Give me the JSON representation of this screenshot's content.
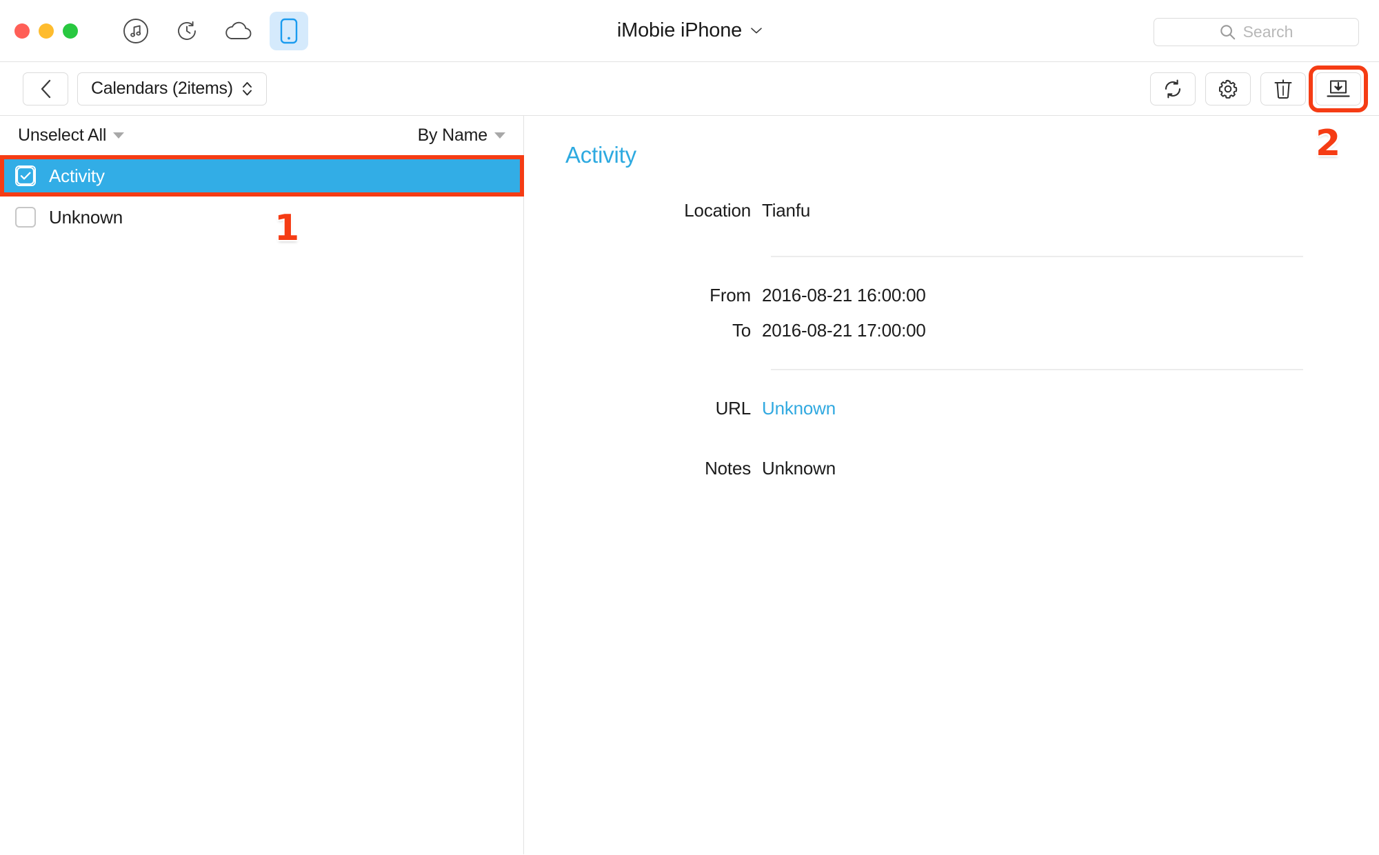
{
  "titlebar": {
    "device_title": "iMobie iPhone",
    "tabs": [
      {
        "name": "music-tab",
        "icon": "music-note-icon",
        "active": false
      },
      {
        "name": "backup-tab",
        "icon": "history-clock-icon",
        "active": false
      },
      {
        "name": "cloud-tab",
        "icon": "cloud-icon",
        "active": false
      },
      {
        "name": "device-tab",
        "icon": "phone-icon",
        "active": true
      }
    ],
    "window_controls": [
      "close",
      "minimize",
      "maximize"
    ]
  },
  "search": {
    "placeholder": "Search",
    "value": ""
  },
  "subtoolbar": {
    "back_label": "Back",
    "breadcrumb_label": "Calendars (2items)",
    "actions": [
      {
        "name": "refresh-button",
        "icon": "refresh-icon",
        "highlighted": false
      },
      {
        "name": "settings-button",
        "icon": "gear-icon",
        "highlighted": false
      },
      {
        "name": "delete-button",
        "icon": "trash-icon",
        "highlighted": false
      },
      {
        "name": "export-button",
        "icon": "export-to-mac-icon",
        "highlighted": true
      }
    ]
  },
  "list": {
    "select_all_label": "Unselect All",
    "sort_label": "By Name",
    "rows": [
      {
        "label": "Activity",
        "checked": true,
        "selected": true,
        "highlighted": true
      },
      {
        "label": "Unknown",
        "checked": false,
        "selected": false,
        "highlighted": false
      }
    ]
  },
  "detail": {
    "title": "Activity",
    "fields": [
      {
        "key": "Location",
        "value": "Tianfu",
        "link": false
      },
      {
        "key": "From",
        "value": "2016-08-21 16:00:00",
        "link": false
      },
      {
        "key": "To",
        "value": "2016-08-21 17:00:00",
        "link": false
      },
      {
        "key": "URL",
        "value": "Unknown",
        "link": true
      },
      {
        "key": "Notes",
        "value": "Unknown",
        "link": false
      }
    ]
  },
  "annotations": [
    {
      "name": "annotation-step-1",
      "label": "1"
    },
    {
      "name": "annotation-step-2",
      "label": "2"
    }
  ],
  "colors": {
    "accent_blue": "#32ade6",
    "link_blue": "#31a9e0",
    "annotation_red": "#f53c14",
    "active_tab_bg": "#d5eafc"
  }
}
